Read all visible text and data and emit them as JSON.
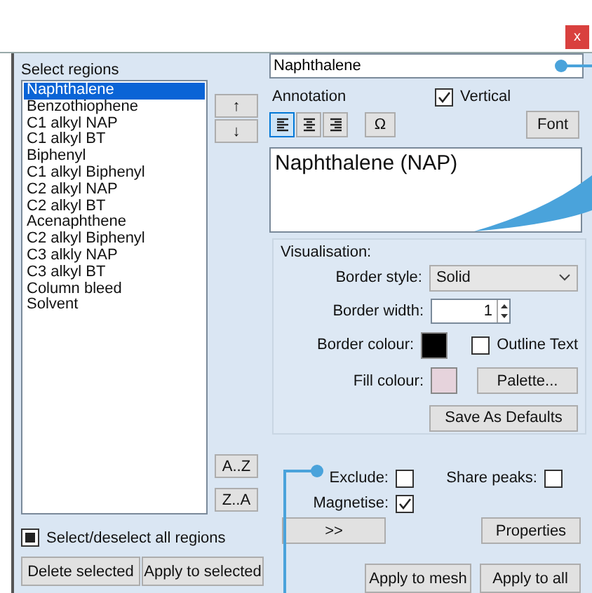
{
  "window": {
    "close_label": "x"
  },
  "regions": {
    "label": "Select regions",
    "items": [
      {
        "label": "Naphthalene",
        "selected": true
      },
      {
        "label": "Benzothiophene",
        "selected": false
      },
      {
        "label": "C1 alkyl NAP",
        "selected": false
      },
      {
        "label": "C1 alkyl BT",
        "selected": false
      },
      {
        "label": "Biphenyl",
        "selected": false
      },
      {
        "label": "C1 alkyl Biphenyl",
        "selected": false
      },
      {
        "label": "C2 alkyl NAP",
        "selected": false
      },
      {
        "label": "C2 alkyl BT",
        "selected": false
      },
      {
        "label": "Acenaphthene",
        "selected": false
      },
      {
        "label": "C2 alkyl Biphenyl",
        "selected": false
      },
      {
        "label": "C3 alkly NAP",
        "selected": false
      },
      {
        "label": "C3 alkyl BT",
        "selected": false
      },
      {
        "label": "Column bleed",
        "selected": false
      },
      {
        "label": "Solvent",
        "selected": false
      }
    ],
    "move_up": "↑",
    "move_down": "↓",
    "sort_az": "A..Z",
    "sort_za": "Z..A",
    "select_all": {
      "label": "Select/deselect all regions",
      "indeterminate": true
    },
    "buttons": [
      "Delete selected",
      "Apply to selected"
    ]
  },
  "name_field": {
    "value": "Naphthalene"
  },
  "annotation": {
    "label": "Annotation",
    "vertical": {
      "label": "Vertical",
      "checked": true
    },
    "align": [
      {
        "kind": "left",
        "selected": true
      },
      {
        "kind": "center",
        "selected": false
      },
      {
        "kind": "right",
        "selected": false
      }
    ],
    "symbol_button": "Ω",
    "font_button": "Font",
    "text": "Naphthalene (NAP)"
  },
  "visualisation": {
    "title": "Visualisation:",
    "border_style": {
      "label": "Border style:",
      "value": "Solid"
    },
    "border_width": {
      "label": "Border width:",
      "value": "1"
    },
    "border_colour": {
      "label": "Border colour:",
      "color": "#000000"
    },
    "outline_text": {
      "label": "Outline Text",
      "checked": false
    },
    "fill_colour": {
      "label": "Fill colour:",
      "color": "#e6d3dc"
    },
    "palette_button": "Palette...",
    "save_defaults_button": "Save As Defaults"
  },
  "options": {
    "exclude": {
      "label": "Exclude:",
      "checked": false
    },
    "share_peaks": {
      "label": "Share peaks:",
      "checked": false
    },
    "magnetise": {
      "label": "Magnetise:",
      "checked": true
    },
    "expand_button": ">>",
    "properties_button": "Properties",
    "apply_mesh_button": "Apply to mesh",
    "apply_all_button": "Apply to all"
  }
}
